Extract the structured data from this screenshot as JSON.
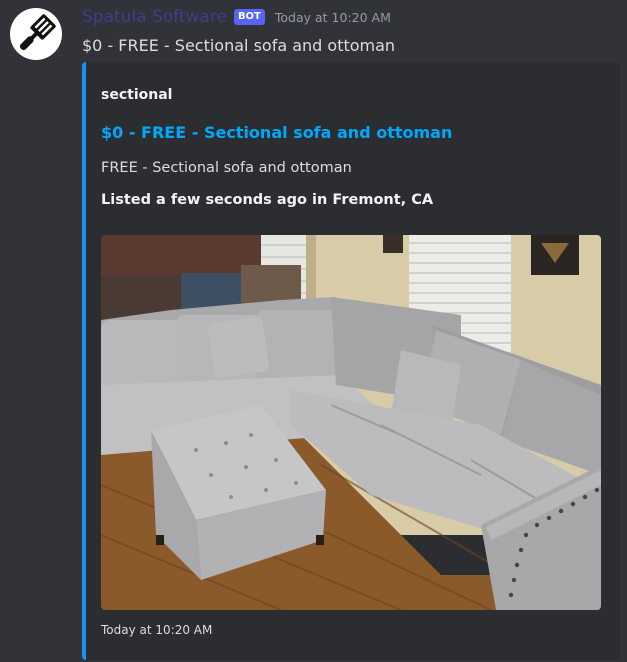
{
  "message": {
    "username": "Spatula Software",
    "bot_tag": "BOT",
    "timestamp": "Today at 10:20 AM",
    "content": "$0 - FREE - Sectional sofa and ottoman"
  },
  "embed": {
    "accent_color": "#1f8ef1",
    "author": "sectional",
    "title": "$0 - FREE - Sectional sofa and ottoman",
    "description": "FREE - Sectional sofa and ottoman",
    "listing_info": "Listed a few seconds ago in Fremont, CA",
    "image_description": "photo-gray-sectional-sofa-and-ottoman",
    "footer_timestamp": "Today at 10:20 AM"
  },
  "colors": {
    "background": "#313338",
    "embed_background": "#2b2d31",
    "link": "#00a8fc",
    "bot_tag": "#5865f2"
  },
  "icons": {
    "avatar": "spatula-icon"
  }
}
